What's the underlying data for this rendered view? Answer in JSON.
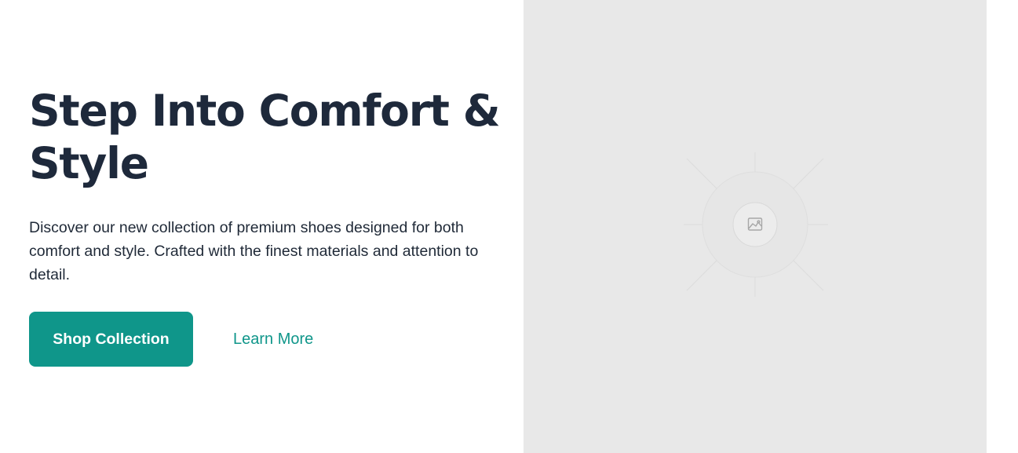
{
  "hero": {
    "title": "Step Into Comfort & Style",
    "description": "Discover our new collection of premium shoes designed for both comfort and style. Crafted with the finest materials and attention to detail.",
    "primary_button": "Shop Collection",
    "secondary_link": "Learn More"
  },
  "media": {
    "icon": "image-placeholder-icon"
  },
  "colors": {
    "heading": "#1e293b",
    "body_text": "#1f2937",
    "accent": "#0f968a",
    "media_background": "#e8e8e8"
  }
}
